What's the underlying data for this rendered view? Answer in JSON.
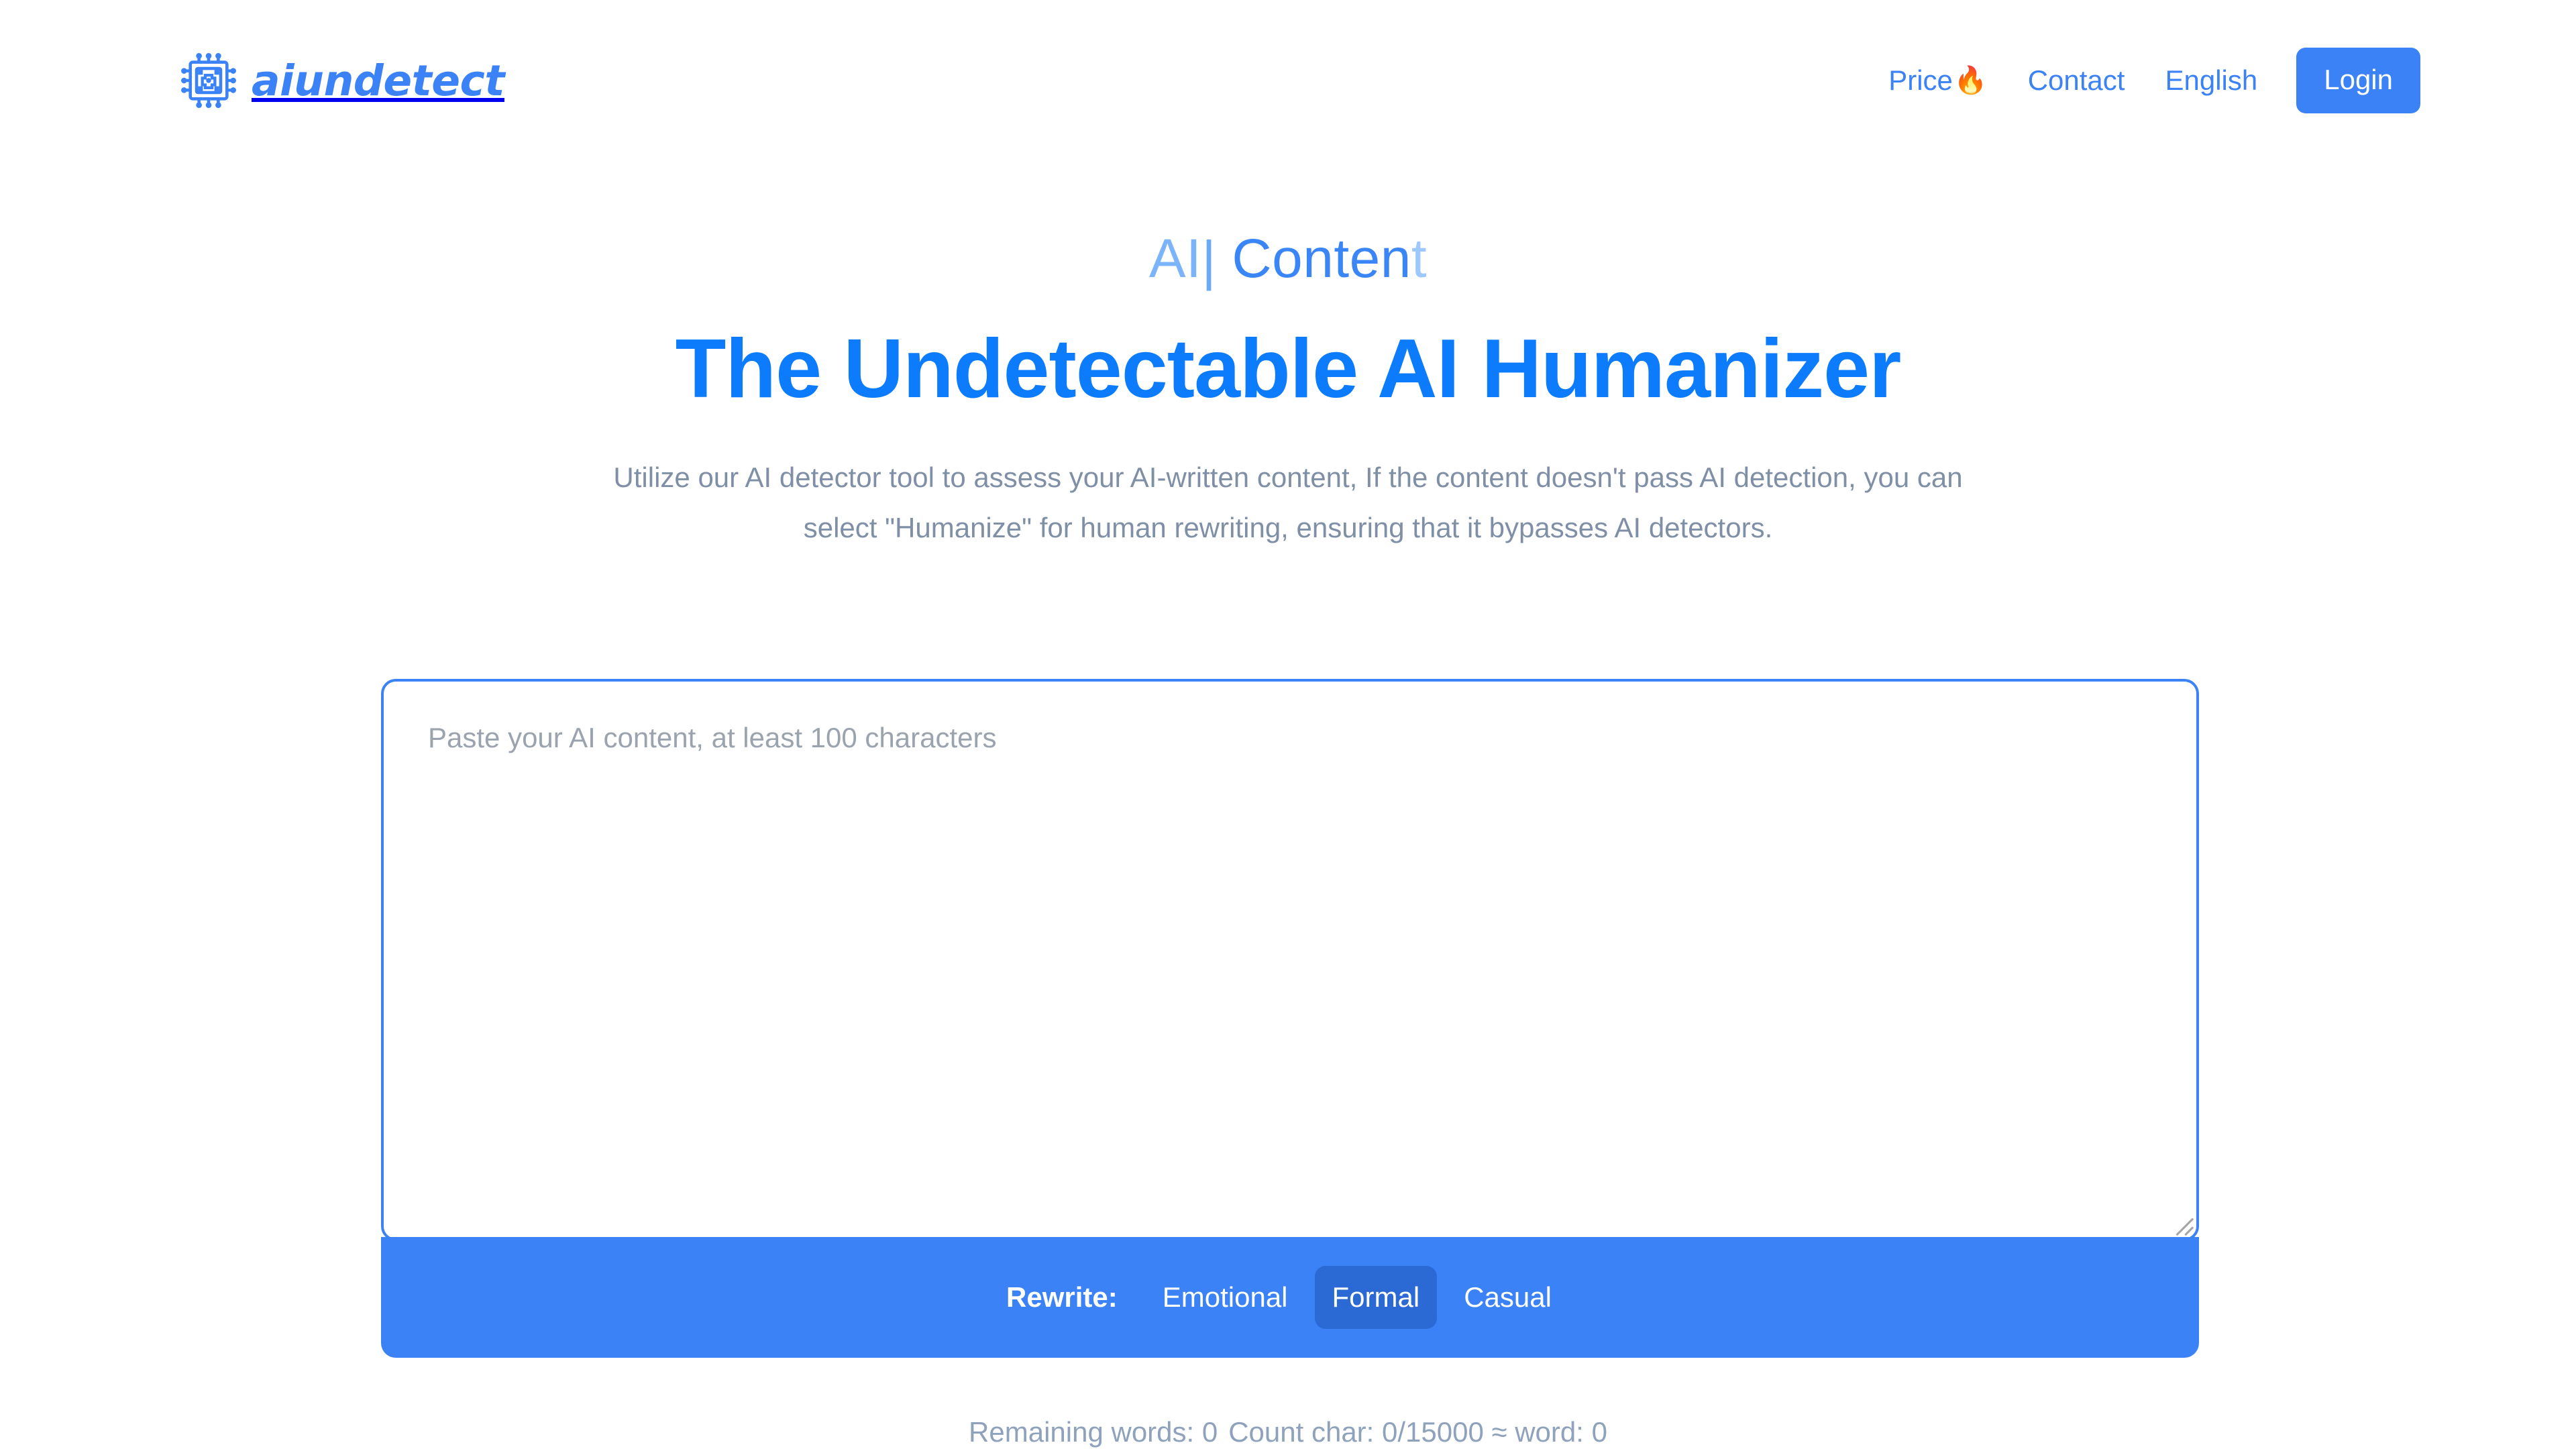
{
  "brand": {
    "name": "aiundetect",
    "icon": "chip-icon",
    "color": "#3B82F6"
  },
  "nav": {
    "price": "Price",
    "price_emoji": "🔥",
    "contact": "Contact",
    "language": "English",
    "login": "Login",
    "link_color": "#3B82F6",
    "login_bg": "#3B82F6"
  },
  "hero": {
    "typing": {
      "part_a": "AI",
      "caret": "|",
      "part_b": " Conten",
      "part_c": "t"
    },
    "headline": "The Undetectable AI Humanizer",
    "subtitle_line1": "Utilize our AI detector tool to assess your AI-written content, If the content doesn't pass AI",
    "subtitle_line2": "detection, you can select \"Humanize\" for human rewriting, ensuring that it bypasses AI detectors.",
    "headline_color": "#0D7CFC"
  },
  "editor": {
    "placeholder": "Paste your AI content, at least 100 characters",
    "value": "",
    "border_color": "#3B82F6"
  },
  "toolbar": {
    "rewrite_label": "Rewrite:",
    "tones": [
      {
        "label": "Emotional",
        "selected": false
      },
      {
        "label": "Formal",
        "selected": true
      },
      {
        "label": "Casual",
        "selected": false
      }
    ],
    "bg": "#3B82F6",
    "selected_bg": "#2B69D4"
  },
  "counter": {
    "remaining_words": "Remaining words: 0",
    "count_char": "Count char: 0/15000 ≈ word: 0"
  }
}
